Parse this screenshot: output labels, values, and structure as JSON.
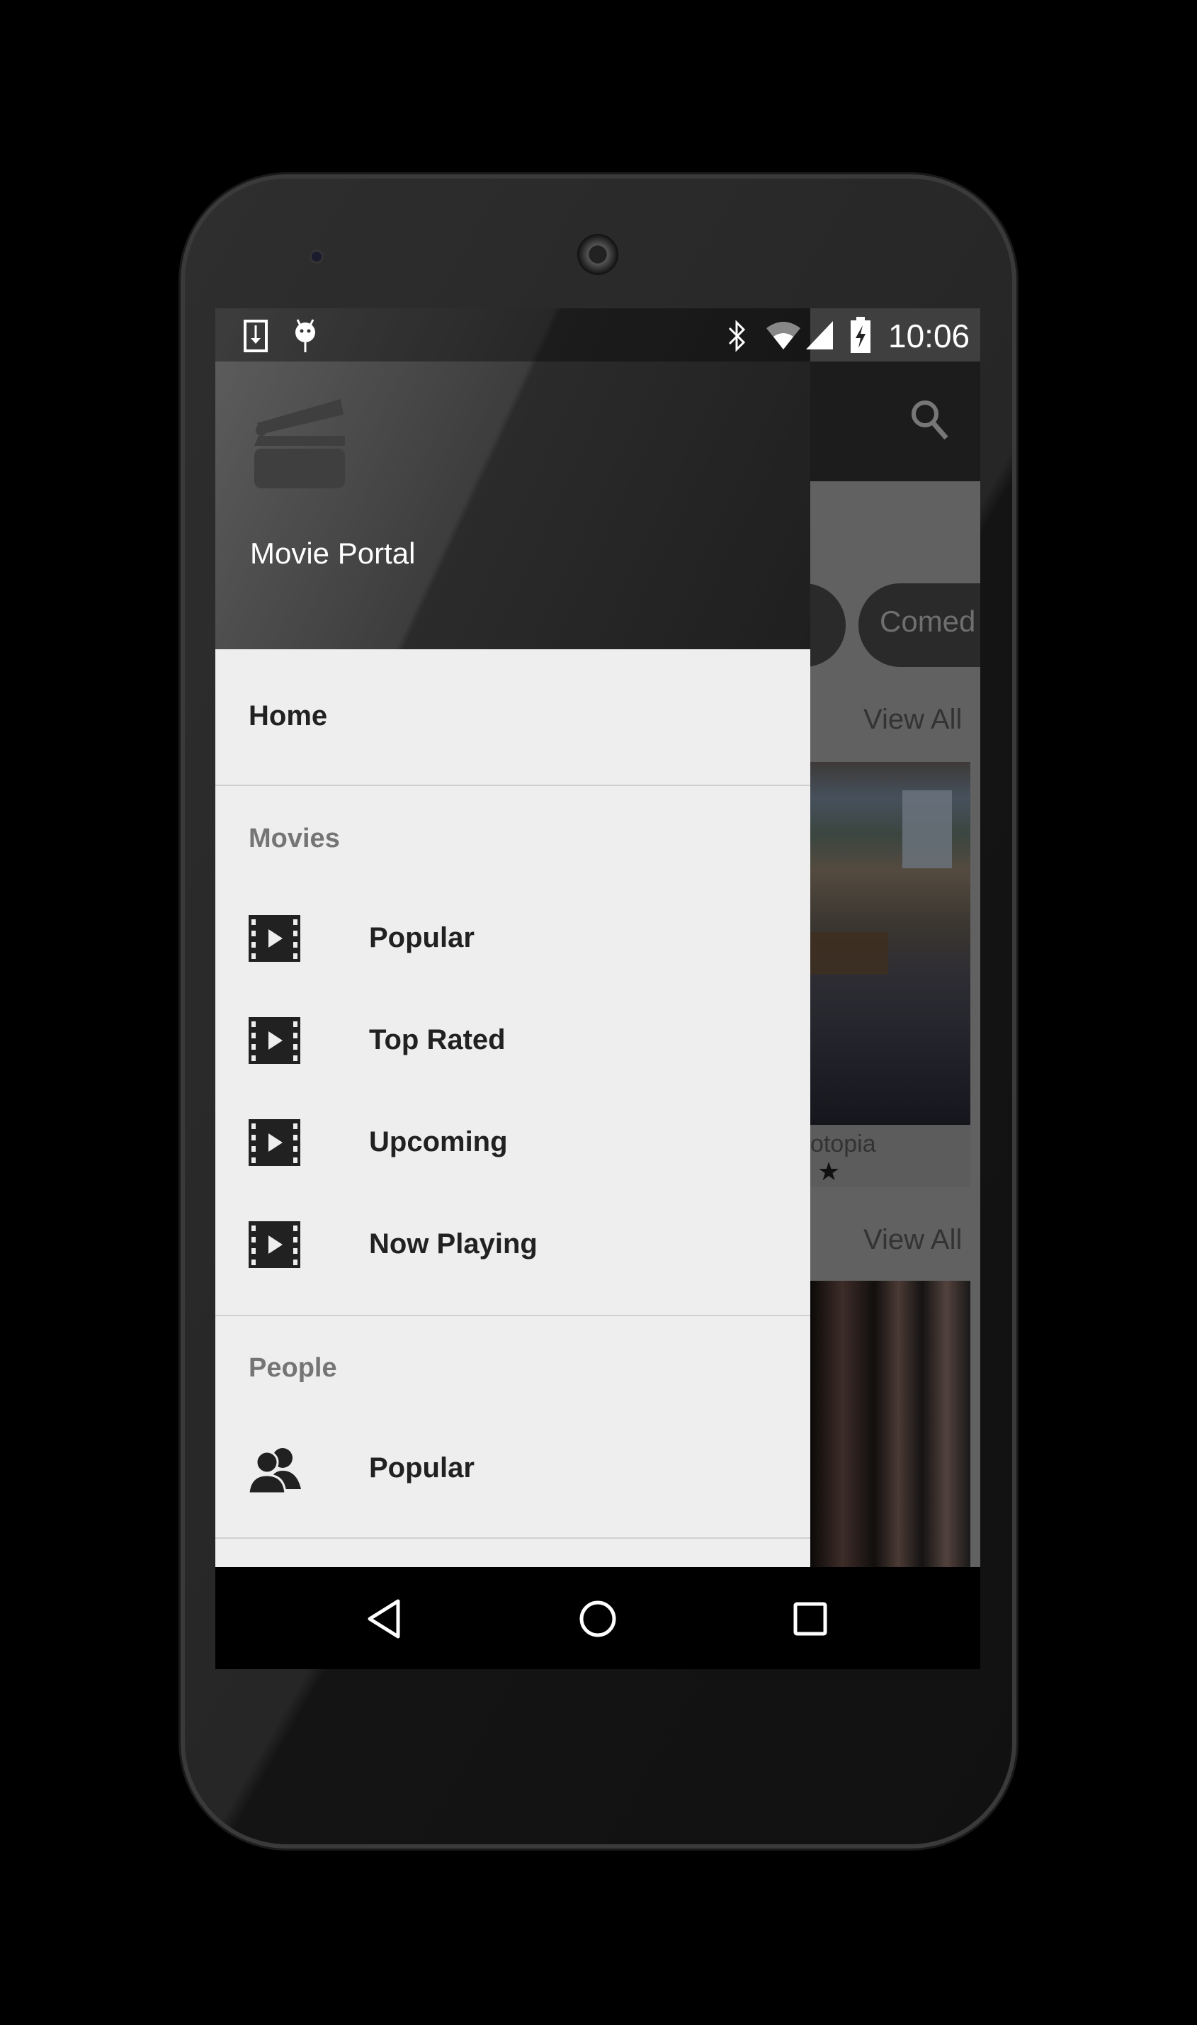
{
  "status_bar": {
    "time": "10:06",
    "left_icons": [
      "download-icon",
      "android-debug-icon"
    ],
    "right_icons": [
      "bluetooth-icon",
      "wifi-icon",
      "signal-icon",
      "battery-charging-icon"
    ]
  },
  "drawer": {
    "app_name": "Movie Portal",
    "home_label": "Home",
    "sections": [
      {
        "title": "Movies",
        "items": [
          {
            "label": "Popular",
            "icon": "film-icon"
          },
          {
            "label": "Top Rated",
            "icon": "film-icon"
          },
          {
            "label": "Upcoming",
            "icon": "film-icon"
          },
          {
            "label": "Now Playing",
            "icon": "film-icon"
          }
        ]
      },
      {
        "title": "People",
        "items": [
          {
            "label": "Popular",
            "icon": "people-icon"
          }
        ]
      }
    ]
  },
  "background": {
    "chip_label": "Comed",
    "view_all": "View All",
    "movie_title": "otopia"
  },
  "colors": {
    "drawer_bg": "#eeeeee",
    "header_dark": "#1f1f1f",
    "scrim_content": "#616161"
  }
}
